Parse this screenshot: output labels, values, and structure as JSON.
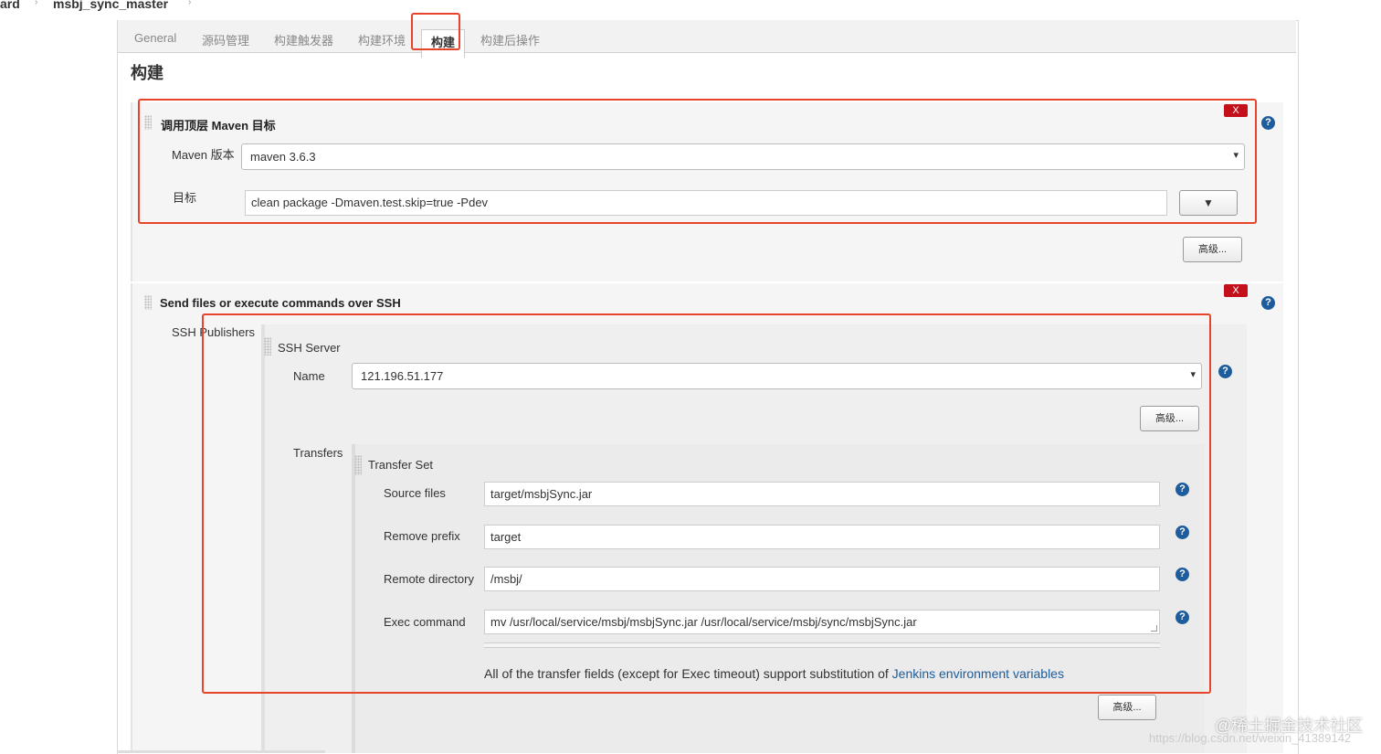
{
  "breadcrumb": {
    "items": [
      "ard",
      "msbj_sync_master"
    ]
  },
  "tabs": [
    {
      "label": "General"
    },
    {
      "label": "源码管理"
    },
    {
      "label": "构建触发器"
    },
    {
      "label": "构建环境"
    },
    {
      "label": "构建"
    },
    {
      "label": "构建后操作"
    }
  ],
  "section_title": "构建",
  "maven_step": {
    "title": "调用顶层 Maven 目标",
    "delete_label": "X",
    "version_label": "Maven 版本",
    "version_value": "maven 3.6.3",
    "goals_label": "目标",
    "goals_value": "clean package -Dmaven.test.skip=true -Pdev",
    "expand_label": "▼",
    "advanced_label": "高级..."
  },
  "ssh_step": {
    "title": "Send files or execute commands over SSH",
    "delete_label": "X",
    "publishers_label": "SSH Publishers",
    "server_title": "SSH Server",
    "name_label": "Name",
    "name_value": "121.196.51.177",
    "server_advanced_label": "高级...",
    "transfers_label": "Transfers",
    "transfer_set_title": "Transfer Set",
    "source_files_label": "Source files",
    "source_files_value": "target/msbjSync.jar",
    "remove_prefix_label": "Remove prefix",
    "remove_prefix_value": "target",
    "remote_directory_label": "Remote directory",
    "remote_directory_value": "/msbj/",
    "exec_command_label": "Exec command",
    "exec_command_value": "mv /usr/local/service/msbj/msbjSync.jar /usr/local/service/msbj/sync/msbjSync.jar",
    "note_text": "All of the transfer fields (except for Exec timeout) support substitution of ",
    "note_link": "Jenkins environment variables",
    "transfer_advanced_label": "高级..."
  },
  "help_icon_text": "?",
  "watermark": {
    "main": "@稀土掘金技术社区",
    "sub": "https://blog.csdn.net/weixin_41389142"
  },
  "colors": {
    "highlight": "#e8442c",
    "delete_button": "#c4101b",
    "help_icon": "#1d5d9d",
    "link": "#1d5d9d"
  }
}
